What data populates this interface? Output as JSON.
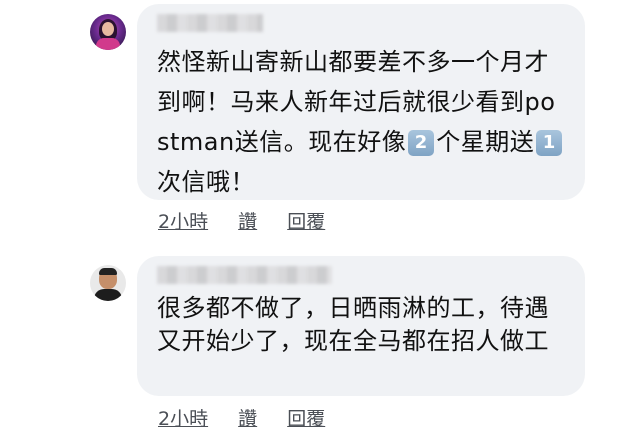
{
  "comments": [
    {
      "text_parts": [
        "然怪新山寄新山都要差不多一个月才到啊！马来人新年过后就很少看到postman送信。现在好像",
        "2",
        "个星期送",
        "1",
        "次信哦！"
      ],
      "time": "2小時",
      "like": "讚",
      "reply": "回覆"
    },
    {
      "text": "很多都不做了，日晒雨淋的工，待遇又开始少了，现在全马都在招人做工",
      "time": "2小時",
      "like": "讚",
      "reply": "回覆"
    }
  ],
  "colors": {
    "bubble": "#f0f2f5",
    "keycap": "#8fb0cf"
  }
}
